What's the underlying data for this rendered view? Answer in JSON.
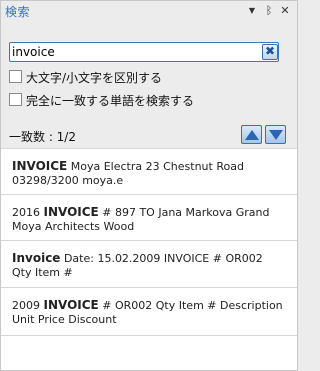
{
  "panel": {
    "title": "検索",
    "controls": {
      "dropdown": "▼",
      "pin": "ᛒ",
      "close": "✕"
    }
  },
  "search": {
    "value": "invoice",
    "clear_glyph": "✖"
  },
  "options": {
    "match_case_label": "大文字/小文字を区別する",
    "whole_word_label": "完全に一致する単語を検索する",
    "match_case_checked": false,
    "whole_word_checked": false
  },
  "count": {
    "label": "一致数 : 1/2"
  },
  "results": [
    {
      "pre": "",
      "match": "INVOICE",
      "post": "  Moya Electra 23 Chestnut Road 03298/3200 moya.e"
    },
    {
      "pre": "2016 ",
      "match": "INVOICE",
      "post": " # 897 TO Jana Markova  Grand Moya Architects Wood"
    },
    {
      "pre": "",
      "match": "Invoice",
      "post": "  Date: 15.02.2009 INVOICE # OR002       Qty Item #"
    },
    {
      "pre": "2009 ",
      "match": "INVOICE",
      "post": " # OR002       Qty Item # Description Unit Price Discount"
    }
  ],
  "colors": {
    "accent": "#3a6fd0",
    "nav_button": "#2b63b5"
  }
}
